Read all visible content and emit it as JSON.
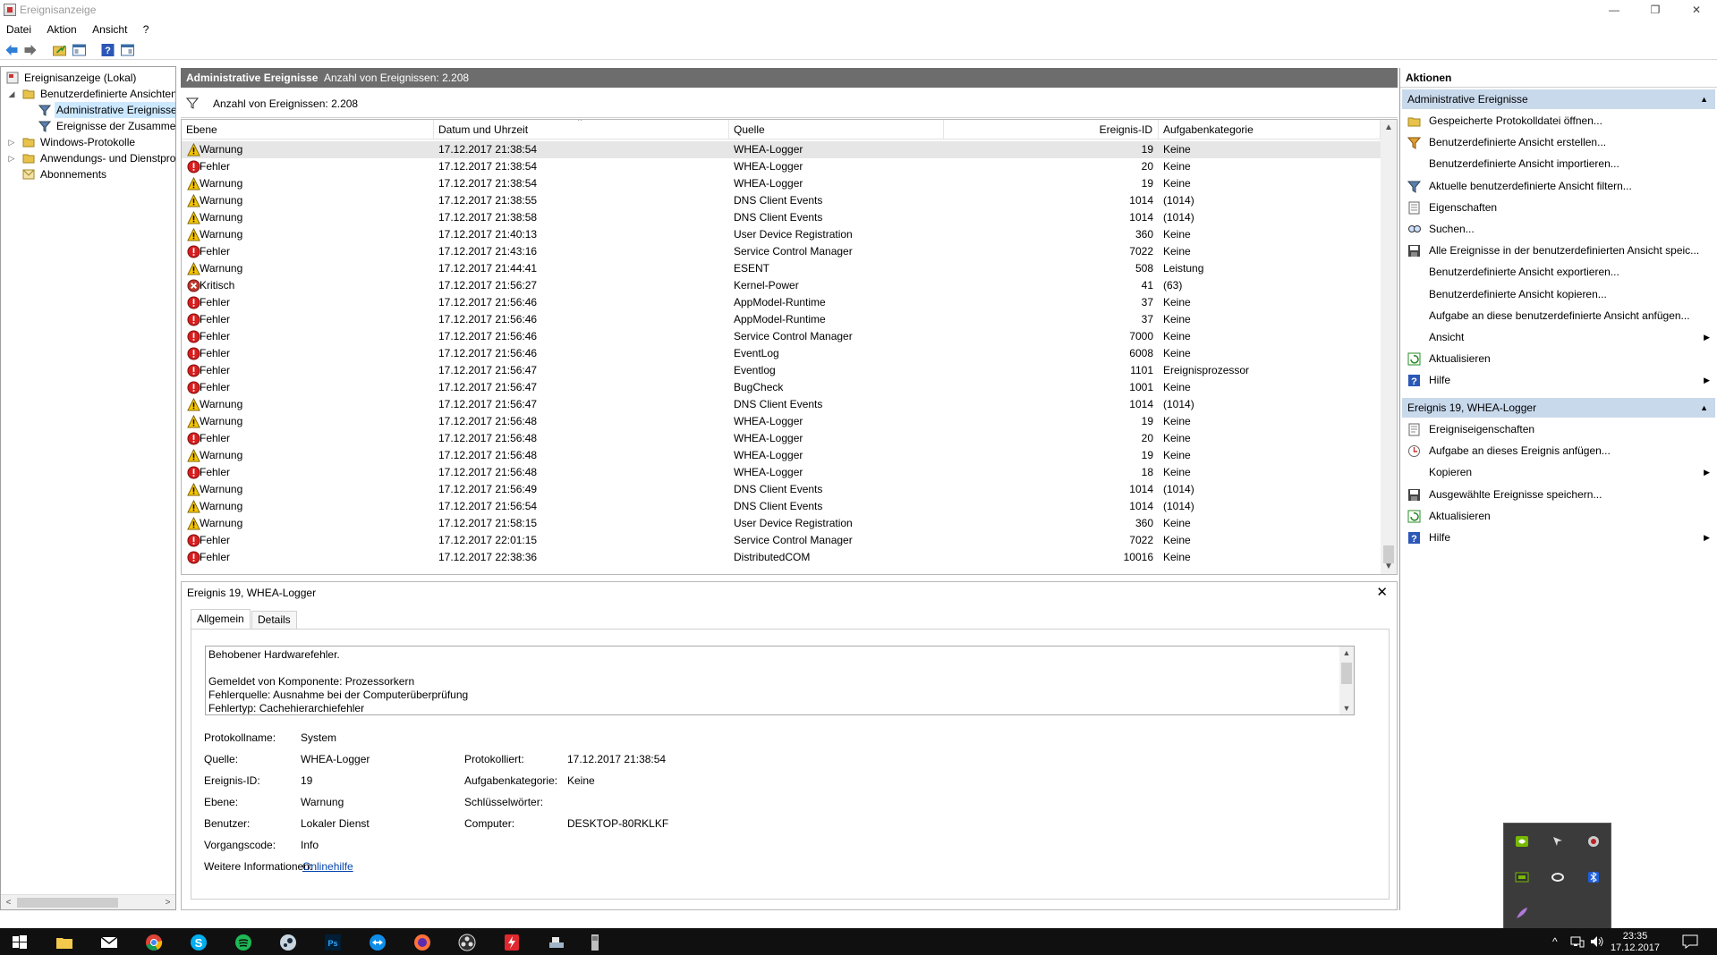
{
  "window": {
    "title": "Ereignisanzeige",
    "minimize": "—",
    "maximize": "❐",
    "close": "✕"
  },
  "menu": [
    "Datei",
    "Aktion",
    "Ansicht",
    "?"
  ],
  "toolbar": [
    "back-icon",
    "forward-icon",
    "open-folder-icon",
    "show-hide-tree-icon",
    "help-icon",
    "show-hide-action-pane-icon"
  ],
  "tree": {
    "root": "Ereignisanzeige (Lokal)",
    "custom_views": "Benutzerdefinierte Ansichten",
    "admin_events": "Administrative Ereignisse",
    "summary_events": "Ereignisse der Zusammenfassung",
    "windows_logs": "Windows-Protokolle",
    "app_service_logs": "Anwendungs- und Dienstprotokolle",
    "subscriptions": "Abonnements",
    "scroll_left": "<",
    "scroll_right": ">"
  },
  "center": {
    "header_title": "Administrative Ereignisse",
    "header_count": "Anzahl von Ereignissen: 2.208",
    "filter_text": "Anzahl von Ereignissen: 2.208",
    "sort_indicator": "^"
  },
  "table": {
    "columns": [
      "Ebene",
      "Datum und Uhrzeit",
      "Quelle",
      "Ereignis-ID",
      "Aufgabenkategorie"
    ],
    "rows": [
      {
        "level": "Warnung",
        "date": "17.12.2017 21:38:54",
        "source": "WHEA-Logger",
        "id": "19",
        "cat": "Keine"
      },
      {
        "level": "Fehler",
        "date": "17.12.2017 21:38:54",
        "source": "WHEA-Logger",
        "id": "20",
        "cat": "Keine"
      },
      {
        "level": "Warnung",
        "date": "17.12.2017 21:38:54",
        "source": "WHEA-Logger",
        "id": "19",
        "cat": "Keine"
      },
      {
        "level": "Warnung",
        "date": "17.12.2017 21:38:55",
        "source": "DNS Client Events",
        "id": "1014",
        "cat": "(1014)"
      },
      {
        "level": "Warnung",
        "date": "17.12.2017 21:38:58",
        "source": "DNS Client Events",
        "id": "1014",
        "cat": "(1014)"
      },
      {
        "level": "Warnung",
        "date": "17.12.2017 21:40:13",
        "source": "User Device Registration",
        "id": "360",
        "cat": "Keine"
      },
      {
        "level": "Fehler",
        "date": "17.12.2017 21:43:16",
        "source": "Service Control Manager",
        "id": "7022",
        "cat": "Keine"
      },
      {
        "level": "Warnung",
        "date": "17.12.2017 21:44:41",
        "source": "ESENT",
        "id": "508",
        "cat": "Leistung"
      },
      {
        "level": "Kritisch",
        "date": "17.12.2017 21:56:27",
        "source": "Kernel-Power",
        "id": "41",
        "cat": "(63)"
      },
      {
        "level": "Fehler",
        "date": "17.12.2017 21:56:46",
        "source": "AppModel-Runtime",
        "id": "37",
        "cat": "Keine"
      },
      {
        "level": "Fehler",
        "date": "17.12.2017 21:56:46",
        "source": "AppModel-Runtime",
        "id": "37",
        "cat": "Keine"
      },
      {
        "level": "Fehler",
        "date": "17.12.2017 21:56:46",
        "source": "Service Control Manager",
        "id": "7000",
        "cat": "Keine"
      },
      {
        "level": "Fehler",
        "date": "17.12.2017 21:56:46",
        "source": "EventLog",
        "id": "6008",
        "cat": "Keine"
      },
      {
        "level": "Fehler",
        "date": "17.12.2017 21:56:47",
        "source": "Eventlog",
        "id": "1101",
        "cat": "Ereignisprozessor"
      },
      {
        "level": "Fehler",
        "date": "17.12.2017 21:56:47",
        "source": "BugCheck",
        "id": "1001",
        "cat": "Keine"
      },
      {
        "level": "Warnung",
        "date": "17.12.2017 21:56:47",
        "source": "DNS Client Events",
        "id": "1014",
        "cat": "(1014)"
      },
      {
        "level": "Warnung",
        "date": "17.12.2017 21:56:48",
        "source": "WHEA-Logger",
        "id": "19",
        "cat": "Keine"
      },
      {
        "level": "Fehler",
        "date": "17.12.2017 21:56:48",
        "source": "WHEA-Logger",
        "id": "20",
        "cat": "Keine"
      },
      {
        "level": "Warnung",
        "date": "17.12.2017 21:56:48",
        "source": "WHEA-Logger",
        "id": "19",
        "cat": "Keine"
      },
      {
        "level": "Fehler",
        "date": "17.12.2017 21:56:48",
        "source": "WHEA-Logger",
        "id": "18",
        "cat": "Keine"
      },
      {
        "level": "Warnung",
        "date": "17.12.2017 21:56:49",
        "source": "DNS Client Events",
        "id": "1014",
        "cat": "(1014)"
      },
      {
        "level": "Warnung",
        "date": "17.12.2017 21:56:54",
        "source": "DNS Client Events",
        "id": "1014",
        "cat": "(1014)"
      },
      {
        "level": "Warnung",
        "date": "17.12.2017 21:58:15",
        "source": "User Device Registration",
        "id": "360",
        "cat": "Keine"
      },
      {
        "level": "Fehler",
        "date": "17.12.2017 22:01:15",
        "source": "Service Control Manager",
        "id": "7022",
        "cat": "Keine"
      },
      {
        "level": "Fehler",
        "date": "17.12.2017 22:38:36",
        "source": "DistributedCOM",
        "id": "10016",
        "cat": "Keine"
      }
    ]
  },
  "details": {
    "title": "Ereignis 19, WHEA-Logger",
    "close": "✕",
    "tab_general": "Allgemein",
    "tab_details": "Details",
    "desc_lines": [
      "Behobener Hardwarefehler.",
      "",
      "Gemeldet von Komponente: Prozessorkern",
      "Fehlerquelle: Ausnahme bei der Computerüberprüfung",
      "Fehlertyp: Cachehierarchiefehler"
    ],
    "props": {
      "log_name_label": "Protokollname:",
      "log_name": "System",
      "source_label": "Quelle:",
      "source": "WHEA-Logger",
      "logged_label": "Protokolliert:",
      "logged": "17.12.2017 21:38:54",
      "event_id_label": "Ereignis-ID:",
      "event_id": "19",
      "task_cat_label": "Aufgabenkategorie:",
      "task_cat": "Keine",
      "level_label": "Ebene:",
      "level": "Warnung",
      "keywords_label": "Schlüsselwörter:",
      "keywords": "",
      "user_label": "Benutzer:",
      "user": "Lokaler Dienst",
      "computer_label": "Computer:",
      "computer": "DESKTOP-80RKLKF",
      "opcode_label": "Vorgangscode:",
      "opcode": "Info",
      "more_info_label": "Weitere Informationen:",
      "more_info_link": "Onlinehilfe"
    }
  },
  "actions": {
    "header": "Aktionen",
    "section1": "Administrative Ereignisse",
    "items1": [
      {
        "icon": "open-saved-log-icon",
        "label": "Gespeicherte Protokolldatei öffnen...",
        "arrow": ""
      },
      {
        "icon": "create-view-icon",
        "label": "Benutzerdefinierte Ansicht erstellen...",
        "arrow": ""
      },
      {
        "icon": "",
        "label": "Benutzerdefinierte Ansicht importieren...",
        "arrow": ""
      },
      {
        "icon": "filter-icon",
        "label": "Aktuelle benutzerdefinierte Ansicht filtern...",
        "arrow": ""
      },
      {
        "icon": "properties-icon",
        "label": "Eigenschaften",
        "arrow": ""
      },
      {
        "icon": "find-icon",
        "label": "Suchen...",
        "arrow": ""
      },
      {
        "icon": "save-icon",
        "label": "Alle Ereignisse in der benutzerdefinierten Ansicht speic...",
        "arrow": ""
      },
      {
        "icon": "",
        "label": "Benutzerdefinierte Ansicht exportieren...",
        "arrow": ""
      },
      {
        "icon": "",
        "label": "Benutzerdefinierte Ansicht kopieren...",
        "arrow": ""
      },
      {
        "icon": "",
        "label": "Aufgabe an diese benutzerdefinierte Ansicht anfügen...",
        "arrow": ""
      },
      {
        "icon": "",
        "label": "Ansicht",
        "arrow": "▶"
      },
      {
        "icon": "refresh-icon",
        "label": "Aktualisieren",
        "arrow": ""
      },
      {
        "icon": "help-icon",
        "label": "Hilfe",
        "arrow": "▶"
      }
    ],
    "section2": "Ereignis 19, WHEA-Logger",
    "items2": [
      {
        "icon": "event-properties-icon",
        "label": "Ereigniseigenschaften",
        "arrow": ""
      },
      {
        "icon": "attach-task-icon",
        "label": "Aufgabe an dieses Ereignis anfügen...",
        "arrow": ""
      },
      {
        "icon": "",
        "label": "Kopieren",
        "arrow": "▶"
      },
      {
        "icon": "save-icon",
        "label": "Ausgewählte Ereignisse speichern...",
        "arrow": ""
      },
      {
        "icon": "refresh-icon",
        "label": "Aktualisieren",
        "arrow": ""
      },
      {
        "icon": "help-icon",
        "label": "Hilfe",
        "arrow": "▶"
      }
    ],
    "collapse": "▲"
  },
  "tray_popup": [
    "nvidia-icon",
    "cursor-icon",
    "shield-icon",
    "nvidia-share-icon",
    "link-icon",
    "bluetooth-icon",
    "feather-icon"
  ],
  "taskbar": {
    "apps": [
      "windows-start-icon",
      "file-explorer-icon",
      "mail-icon",
      "chrome-icon",
      "skype-icon",
      "spotify-icon",
      "steam-icon",
      "photoshop-icon",
      "teamviewer-icon",
      "firefox-icon",
      "obs-icon",
      "power-icon",
      "network-tool-icon",
      "usb-icon"
    ],
    "time": "23:35",
    "date": "17.12.2017",
    "tray_chevron": "^"
  },
  "colors": {
    "warning": "#f5c400",
    "error": "#d81e1e",
    "critical": "#c0392b",
    "section_bg": "#c9d9ec",
    "header_bg": "#6d6d6d",
    "link": "#0645ad"
  }
}
